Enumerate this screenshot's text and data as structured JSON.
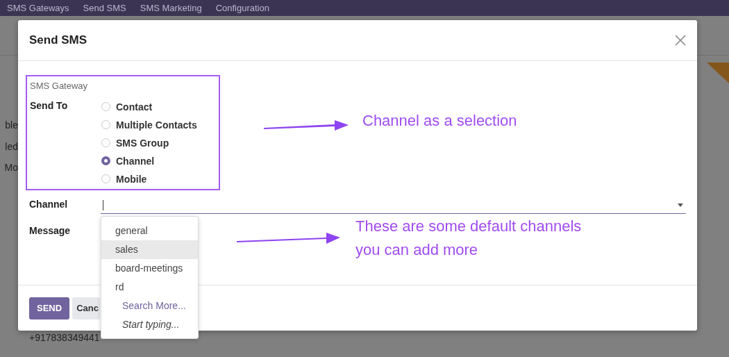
{
  "nav": {
    "items": [
      "SMS Gateways",
      "Send SMS",
      "SMS Marketing",
      "Configuration"
    ]
  },
  "background": {
    "fragments": [
      "ble",
      "led",
      "Mo"
    ],
    "phone": "+917838349441"
  },
  "dialog": {
    "title": "Send SMS",
    "gateway_label": "SMS Gateway",
    "send_to": {
      "label": "Send To",
      "options": [
        {
          "label": "Contact",
          "selected": false
        },
        {
          "label": "Multiple Contacts",
          "selected": false
        },
        {
          "label": "SMS Group",
          "selected": false
        },
        {
          "label": "Channel",
          "selected": true
        },
        {
          "label": "Mobile",
          "selected": false
        }
      ]
    },
    "channel": {
      "label": "Channel",
      "dropdown": {
        "items": [
          {
            "label": "general",
            "highlighted": false
          },
          {
            "label": "sales",
            "highlighted": true
          },
          {
            "label": "board-meetings",
            "highlighted": false
          },
          {
            "label": "rd",
            "highlighted": false
          }
        ],
        "search_more": "Search More...",
        "hint": "Start typing..."
      }
    },
    "message": {
      "label": "Message"
    },
    "buttons": [
      {
        "label": "SEND",
        "kind": "primary"
      },
      {
        "label": "Canc",
        "kind": "secondary"
      }
    ]
  },
  "annotations": [
    {
      "lines": [
        "Channel as a selection"
      ]
    },
    {
      "lines": [
        "These are some default channels",
        "you can add more"
      ]
    }
  ]
}
